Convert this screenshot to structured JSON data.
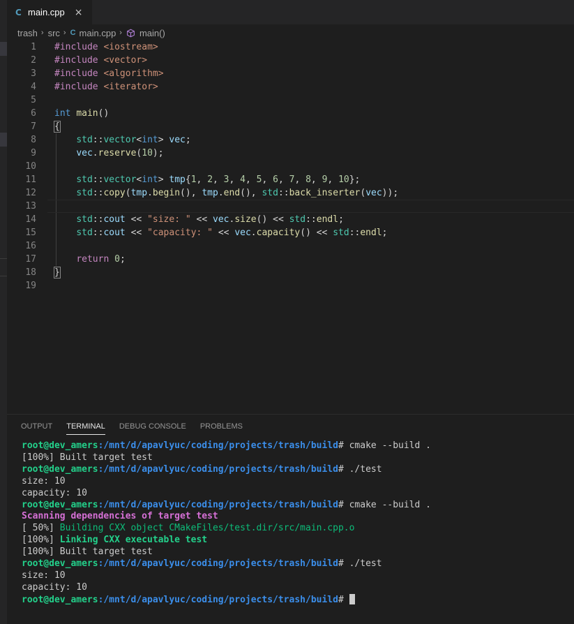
{
  "tab": {
    "icon": "C",
    "title": "main.cpp",
    "close": "×"
  },
  "breadcrumb": {
    "items": [
      "trash",
      "src",
      "main.cpp",
      "main()"
    ],
    "separator": "›"
  },
  "editor": {
    "lines": [
      {
        "n": "1",
        "tokens": [
          [
            "pre",
            "#include "
          ],
          [
            "str",
            "<iostream>"
          ]
        ]
      },
      {
        "n": "2",
        "tokens": [
          [
            "pre",
            "#include "
          ],
          [
            "str",
            "<vector>"
          ]
        ]
      },
      {
        "n": "3",
        "tokens": [
          [
            "pre",
            "#include "
          ],
          [
            "str",
            "<algorithm>"
          ]
        ]
      },
      {
        "n": "4",
        "tokens": [
          [
            "pre",
            "#include "
          ],
          [
            "str",
            "<iterator>"
          ]
        ]
      },
      {
        "n": "5",
        "tokens": []
      },
      {
        "n": "6",
        "tokens": [
          [
            "kw",
            "int"
          ],
          [
            "plain",
            " "
          ],
          [
            "fn",
            "main"
          ],
          [
            "plain",
            "()"
          ]
        ]
      },
      {
        "n": "7",
        "tokens": [
          [
            "brace",
            "{"
          ]
        ]
      },
      {
        "n": "8",
        "tokens": [
          [
            "plain",
            "    "
          ],
          [
            "ns",
            "std"
          ],
          [
            "plain",
            "::"
          ],
          [
            "ns",
            "vector"
          ],
          [
            "plain",
            "<"
          ],
          [
            "kw",
            "int"
          ],
          [
            "plain",
            "> "
          ],
          [
            "var",
            "vec"
          ],
          [
            "plain",
            ";"
          ]
        ]
      },
      {
        "n": "9",
        "tokens": [
          [
            "plain",
            "    "
          ],
          [
            "var",
            "vec"
          ],
          [
            "plain",
            "."
          ],
          [
            "fn",
            "reserve"
          ],
          [
            "plain",
            "("
          ],
          [
            "num",
            "10"
          ],
          [
            "plain",
            ");"
          ]
        ]
      },
      {
        "n": "10",
        "tokens": []
      },
      {
        "n": "11",
        "tokens": [
          [
            "plain",
            "    "
          ],
          [
            "ns",
            "std"
          ],
          [
            "plain",
            "::"
          ],
          [
            "ns",
            "vector"
          ],
          [
            "plain",
            "<"
          ],
          [
            "kw",
            "int"
          ],
          [
            "plain",
            "> "
          ],
          [
            "var",
            "tmp"
          ],
          [
            "plain",
            "{"
          ],
          [
            "num",
            "1"
          ],
          [
            "plain",
            ", "
          ],
          [
            "num",
            "2"
          ],
          [
            "plain",
            ", "
          ],
          [
            "num",
            "3"
          ],
          [
            "plain",
            ", "
          ],
          [
            "num",
            "4"
          ],
          [
            "plain",
            ", "
          ],
          [
            "num",
            "5"
          ],
          [
            "plain",
            ", "
          ],
          [
            "num",
            "6"
          ],
          [
            "plain",
            ", "
          ],
          [
            "num",
            "7"
          ],
          [
            "plain",
            ", "
          ],
          [
            "num",
            "8"
          ],
          [
            "plain",
            ", "
          ],
          [
            "num",
            "9"
          ],
          [
            "plain",
            ", "
          ],
          [
            "num",
            "10"
          ],
          [
            "plain",
            "};"
          ]
        ]
      },
      {
        "n": "12",
        "tokens": [
          [
            "plain",
            "    "
          ],
          [
            "ns",
            "std"
          ],
          [
            "plain",
            "::"
          ],
          [
            "fn",
            "copy"
          ],
          [
            "plain",
            "("
          ],
          [
            "var",
            "tmp"
          ],
          [
            "plain",
            "."
          ],
          [
            "fn",
            "begin"
          ],
          [
            "plain",
            "(), "
          ],
          [
            "var",
            "tmp"
          ],
          [
            "plain",
            "."
          ],
          [
            "fn",
            "end"
          ],
          [
            "plain",
            "(), "
          ],
          [
            "ns",
            "std"
          ],
          [
            "plain",
            "::"
          ],
          [
            "fn",
            "back_inserter"
          ],
          [
            "plain",
            "("
          ],
          [
            "var",
            "vec"
          ],
          [
            "plain",
            "));"
          ]
        ]
      },
      {
        "n": "13",
        "tokens": []
      },
      {
        "n": "14",
        "tokens": [
          [
            "plain",
            "    "
          ],
          [
            "ns",
            "std"
          ],
          [
            "plain",
            "::"
          ],
          [
            "var",
            "cout"
          ],
          [
            "plain",
            " << "
          ],
          [
            "str",
            "\"size: \""
          ],
          [
            "plain",
            " << "
          ],
          [
            "var",
            "vec"
          ],
          [
            "plain",
            "."
          ],
          [
            "fn",
            "size"
          ],
          [
            "plain",
            "() << "
          ],
          [
            "ns",
            "std"
          ],
          [
            "plain",
            "::"
          ],
          [
            "fn",
            "endl"
          ],
          [
            "plain",
            ";"
          ]
        ]
      },
      {
        "n": "15",
        "tokens": [
          [
            "plain",
            "    "
          ],
          [
            "ns",
            "std"
          ],
          [
            "plain",
            "::"
          ],
          [
            "var",
            "cout"
          ],
          [
            "plain",
            " << "
          ],
          [
            "str",
            "\"capacity: \""
          ],
          [
            "plain",
            " << "
          ],
          [
            "var",
            "vec"
          ],
          [
            "plain",
            "."
          ],
          [
            "fn",
            "capacity"
          ],
          [
            "plain",
            "() << "
          ],
          [
            "ns",
            "std"
          ],
          [
            "plain",
            "::"
          ],
          [
            "fn",
            "endl"
          ],
          [
            "plain",
            ";"
          ]
        ]
      },
      {
        "n": "16",
        "tokens": []
      },
      {
        "n": "17",
        "tokens": [
          [
            "plain",
            "    "
          ],
          [
            "ctl",
            "return"
          ],
          [
            "plain",
            " "
          ],
          [
            "num",
            "0"
          ],
          [
            "plain",
            ";"
          ]
        ]
      },
      {
        "n": "18",
        "tokens": [
          [
            "brace",
            "}"
          ]
        ]
      },
      {
        "n": "19",
        "tokens": []
      }
    ],
    "current_line": "13"
  },
  "panel": {
    "tabs": [
      {
        "label": "OUTPUT",
        "active": false
      },
      {
        "label": "TERMINAL",
        "active": true
      },
      {
        "label": "DEBUG CONSOLE",
        "active": false
      },
      {
        "label": "PROBLEMS",
        "active": false
      }
    ]
  },
  "terminal": {
    "user": "root@dev_amers",
    "path": ":/mnt/d/apavlyuc/coding/projects/trash/build",
    "lines": [
      {
        "type": "prompt",
        "cmd": "# cmake --build ."
      },
      {
        "type": "out",
        "text": "[100%] Built target test"
      },
      {
        "type": "prompt",
        "cmd": "# ./test"
      },
      {
        "type": "out",
        "text": "size: 10"
      },
      {
        "type": "out",
        "text": "capacity: 10"
      },
      {
        "type": "prompt",
        "cmd": "# cmake --build ."
      },
      {
        "type": "mag",
        "text": "Scanning dependencies of target test"
      },
      {
        "type": "pct",
        "pct": "[ 50%] ",
        "text": "Building CXX object CMakeFiles/test.dir/src/main.cpp.o",
        "style": "grn"
      },
      {
        "type": "pct",
        "pct": "[100%] ",
        "text": "Linking CXX executable test",
        "style": "grnb"
      },
      {
        "type": "out",
        "text": "[100%] Built target test"
      },
      {
        "type": "prompt",
        "cmd": "# ./test"
      },
      {
        "type": "out",
        "text": "size: 10"
      },
      {
        "type": "out",
        "text": "capacity: 10"
      },
      {
        "type": "prompt",
        "cmd": "# ",
        "cursor": true
      }
    ]
  }
}
